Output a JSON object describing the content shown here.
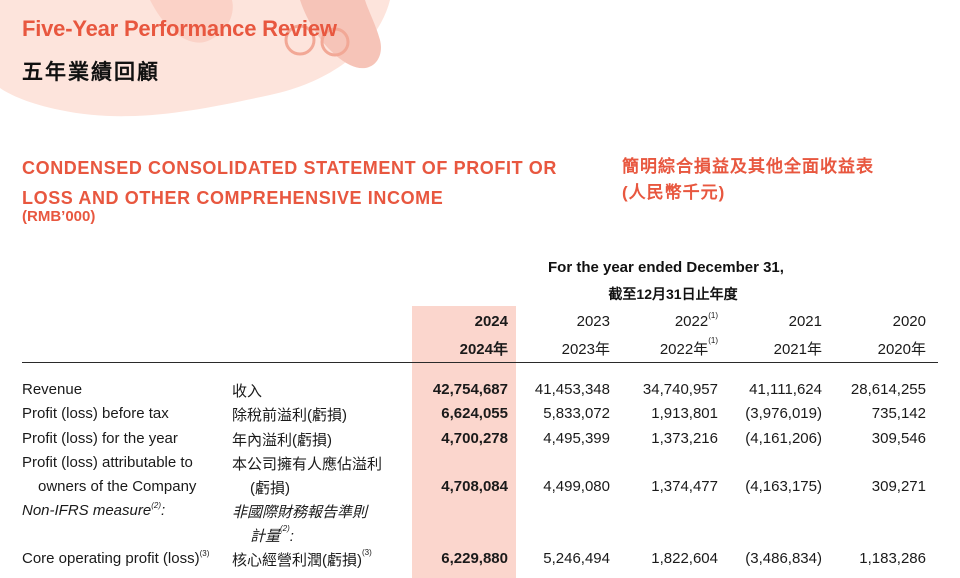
{
  "header": {
    "title_en": "Five-Year Performance Review",
    "title_zh": "五年業績回顧"
  },
  "statement": {
    "title_en_line1": "CONDENSED CONSOLIDATED STATEMENT OF PROFIT OR",
    "title_en_line2": "LOSS AND OTHER COMPREHENSIVE INCOME",
    "unit_en": "(RMB’000)",
    "title_zh": "簡明綜合損益及其他全面收益表",
    "unit_zh": "(人民幣千元)"
  },
  "period": {
    "en": "For the year ended December 31,",
    "zh": "截至12月31日止年度"
  },
  "years": [
    {
      "en": "2024",
      "zh": "2024年",
      "note": ""
    },
    {
      "en": "2023",
      "zh": "2023年",
      "note": ""
    },
    {
      "en": "2022",
      "zh": "2022年",
      "note": "(1)"
    },
    {
      "en": "2021",
      "zh": "2021年",
      "note": ""
    },
    {
      "en": "2020",
      "zh": "2020年",
      "note": ""
    }
  ],
  "rows": [
    {
      "en": "Revenue",
      "zh": "收入",
      "values": [
        "42,754,687",
        "41,453,348",
        "34,740,957",
        "41,111,624",
        "28,614,255"
      ]
    },
    {
      "en": "Profit (loss) before tax",
      "zh": "除稅前溢利(虧損)",
      "values": [
        "6,624,055",
        "5,833,072",
        "1,913,801",
        "(3,976,019)",
        "735,142"
      ]
    },
    {
      "en": "Profit (loss) for the year",
      "zh": "年內溢利(虧損)",
      "values": [
        "4,700,278",
        "4,495,399",
        "1,373,216",
        "(4,161,206)",
        "309,546"
      ]
    },
    {
      "en_line1": "Profit (loss) attributable to",
      "en_line2": "owners of the Company",
      "zh_line1": "本公司擁有人應佔溢利",
      "zh_line2": "(虧損)",
      "values": [
        "4,708,084",
        "4,499,080",
        "1,374,477",
        "(4,163,175)",
        "309,271"
      ]
    },
    {
      "en": "Non-IFRS measure",
      "en_note": "(2)",
      "en_suffix": ":",
      "zh_line1": "非國際財務報告準則",
      "zh_line2": "計量",
      "zh_note": "(2)",
      "zh_suffix": ":"
    },
    {
      "en": "Core operating profit (loss)",
      "en_note": "(3)",
      "zh": "核心經營利潤(虧損)",
      "zh_note": "(3)",
      "values": [
        "6,229,880",
        "5,246,494",
        "1,822,604",
        "(3,486,834)",
        "1,183,286"
      ]
    }
  ],
  "colors": {
    "accent": "#e8573f",
    "highlight": "#fbd6cd",
    "decor": "#f6c4b8"
  }
}
